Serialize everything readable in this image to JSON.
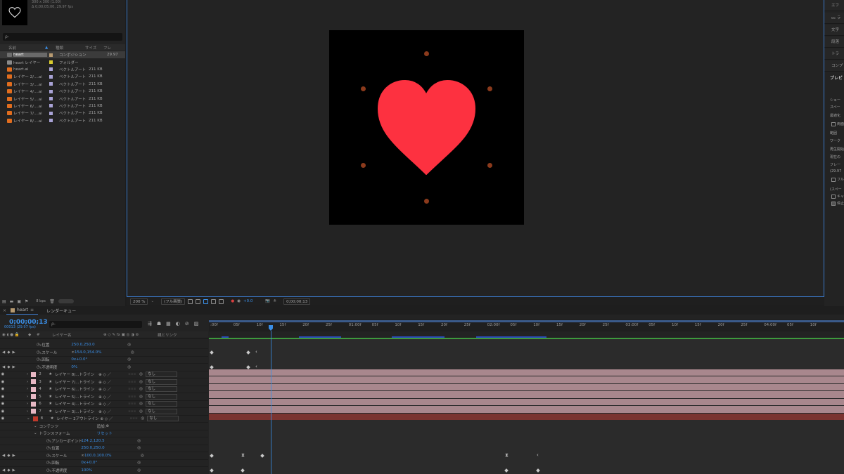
{
  "project": {
    "comp_info_line1": "300 x 300 (1.00)",
    "comp_info_line2": "Δ 0;00;05;00, 29.97 fps",
    "search_placeholder": "ρ-",
    "headers": {
      "name": "名前",
      "type": "種類",
      "size": "サイズ",
      "fps": "フレ"
    },
    "items": [
      {
        "name": "heart",
        "type": "コンポジション",
        "size": "",
        "fps": "29.97",
        "icon": "composition-icon",
        "label_color": "#b79a71",
        "selected": true
      },
      {
        "name": "heart レイヤー",
        "type": "フォルダー",
        "size": "",
        "fps": "",
        "icon": "folder-icon",
        "label_color": "#d9cc2d"
      },
      {
        "name": "heart.ai",
        "type": "ベクトルアート",
        "size": "211 KB",
        "fps": "",
        "icon": "ai-file-icon",
        "label_color": "#a9a3d6"
      },
      {
        "name": "レイヤー 2/....ai",
        "type": "ベクトルアート",
        "size": "211 KB",
        "fps": "",
        "icon": "ai-file-icon",
        "label_color": "#a9a3d6"
      },
      {
        "name": "レイヤー 3/....ai",
        "type": "ベクトルアート",
        "size": "211 KB",
        "fps": "",
        "icon": "ai-file-icon",
        "label_color": "#a9a3d6"
      },
      {
        "name": "レイヤー 4/....ai",
        "type": "ベクトルアート",
        "size": "211 KB",
        "fps": "",
        "icon": "ai-file-icon",
        "label_color": "#a9a3d6"
      },
      {
        "name": "レイヤー 5/....ai",
        "type": "ベクトルアート",
        "size": "211 KB",
        "fps": "",
        "icon": "ai-file-icon",
        "label_color": "#a9a3d6"
      },
      {
        "name": "レイヤー 6/....ai",
        "type": "ベクトルアート",
        "size": "211 KB",
        "fps": "",
        "icon": "ai-file-icon",
        "label_color": "#a9a3d6"
      },
      {
        "name": "レイヤー 7/....ai",
        "type": "ベクトルアート",
        "size": "211 KB",
        "fps": "",
        "icon": "ai-file-icon",
        "label_color": "#a9a3d6"
      },
      {
        "name": "レイヤー 8/....ai",
        "type": "ベクトルアート",
        "size": "211 KB",
        "fps": "",
        "icon": "ai-file-icon",
        "label_color": "#a9a3d6"
      }
    ],
    "bpc": "8 bpc"
  },
  "viewer": {
    "zoom": "200 %",
    "resolution": "(フル画質)",
    "exposure": "+0.0",
    "timecode": "0;00;00;13",
    "heart_color": "#fd3140",
    "dot_color": "#8b3a1c"
  },
  "right_panel": {
    "tabs": [
      "エフ",
      "cc ラ",
      "文字",
      "段落",
      "トラ",
      "コンプ"
    ],
    "preview_title": "プレビ",
    "lines": [
      "ショー",
      "スペー",
      "最適化",
      "両面",
      "範囲",
      "ワーク",
      "再生開始",
      "現在の",
      "フレー",
      "(29.97",
      "フル",
      "(スペー",
      "キャ",
      "停止"
    ]
  },
  "timeline": {
    "comp_tab": "heart",
    "render_queue_tab": "レンダーキュー",
    "timecode": "0;00;00;13",
    "timecode_sub": "00013 (29.97 fps)",
    "search_placeholder": "ρ-",
    "col_layer_name": "レイヤー名",
    "col_parent": "親とリンク",
    "ruler_ticks": [
      ":00f",
      "05f",
      "10f",
      "15f",
      "20f",
      "25f",
      "01:00f",
      "05f",
      "10f",
      "15f",
      "20f",
      "25f",
      "02:00f",
      "05f",
      "10f",
      "15f",
      "20f",
      "25f",
      "03:00f",
      "05f",
      "10f",
      "15f",
      "20f",
      "25f",
      "04:00f",
      "05f",
      "10f"
    ],
    "rows": [
      {
        "kind": "prop",
        "label": "位置",
        "value": "250.0,250.0",
        "indent": 1
      },
      {
        "kind": "prop",
        "label": "スケール",
        "value": "154.0,154.0%",
        "indent": 1,
        "keyframed": true
      },
      {
        "kind": "prop",
        "label": "回転",
        "value": "0x+0.0°",
        "indent": 1
      },
      {
        "kind": "prop",
        "label": "不透明度",
        "value": "0%",
        "indent": 1,
        "keyframed": true
      },
      {
        "kind": "layer",
        "num": "2",
        "name": "レイヤー 8/...トライン",
        "mode": "なし",
        "color": "#e8b8c4"
      },
      {
        "kind": "layer",
        "num": "3",
        "name": "レイヤー 7/...トライン",
        "mode": "なし",
        "color": "#e8b8c4"
      },
      {
        "kind": "layer",
        "num": "4",
        "name": "レイヤー 6/...トライン",
        "mode": "なし",
        "color": "#e8b8c4"
      },
      {
        "kind": "layer",
        "num": "5",
        "name": "レイヤー 5/...トライン",
        "mode": "なし",
        "color": "#e8b8c4"
      },
      {
        "kind": "layer",
        "num": "6",
        "name": "レイヤー 4/...トライン",
        "mode": "なし",
        "color": "#e8b8c4"
      },
      {
        "kind": "layer",
        "num": "7",
        "name": "レイヤー 3/...トライン",
        "mode": "なし",
        "color": "#e8b8c4"
      },
      {
        "kind": "layer",
        "num": "8",
        "name": "レイヤー 2アウトライン",
        "mode": "なし",
        "color": "#c0392b",
        "expanded": true
      },
      {
        "kind": "group",
        "label": "コンテンツ",
        "value": "追加:",
        "indent": 1
      },
      {
        "kind": "group",
        "label": "トランスフォーム",
        "value": "リセット",
        "indent": 1
      },
      {
        "kind": "prop",
        "label": "アンカーポイント",
        "value": "124.2,120.5",
        "indent": 2
      },
      {
        "kind": "prop",
        "label": "位置",
        "value": "250.0,250.0",
        "indent": 2
      },
      {
        "kind": "prop",
        "label": "スケール",
        "value": "100.0,100.0%",
        "indent": 2,
        "keyframed": true
      },
      {
        "kind": "prop",
        "label": "回転",
        "value": "0x+0.0°",
        "indent": 2
      },
      {
        "kind": "prop",
        "label": "不透明度",
        "value": "100%",
        "indent": 2,
        "keyframed": true
      }
    ],
    "layer_bar_color": "#a8878d",
    "selected_bar_color": "#7a3430"
  }
}
